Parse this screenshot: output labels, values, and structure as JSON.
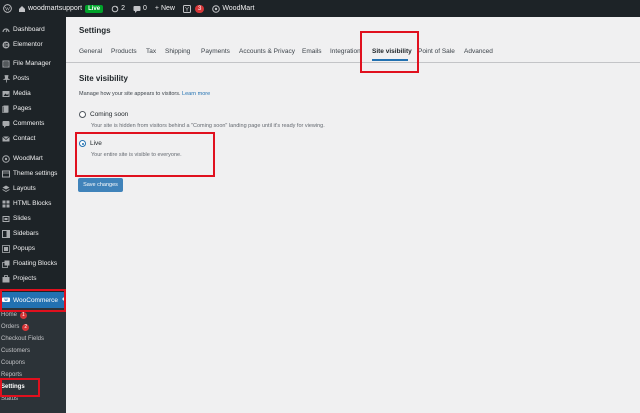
{
  "adminbar": {
    "site_name": "woodmartsupport",
    "live_badge": "Live",
    "updates_count": "2",
    "comments_count": "0",
    "new_label": "+ New",
    "yoast_count": "3",
    "woodmart_label": "WoodMart"
  },
  "sidebar": {
    "items": [
      {
        "label": "Dashboard",
        "icon": "dashboard-icon"
      },
      {
        "label": "Elementor",
        "icon": "elementor-icon"
      },
      {
        "label": "File Manager",
        "icon": "file-manager-icon"
      },
      {
        "label": "Posts",
        "icon": "pushpin-icon"
      },
      {
        "label": "Media",
        "icon": "media-icon"
      },
      {
        "label": "Pages",
        "icon": "pages-icon"
      },
      {
        "label": "Comments",
        "icon": "comments-icon"
      },
      {
        "label": "Contact",
        "icon": "contact-icon"
      },
      {
        "label": "WoodMart",
        "icon": "woodmart-icon"
      },
      {
        "label": "Theme settings",
        "icon": "settings-icon"
      },
      {
        "label": "Layouts",
        "icon": "layouts-icon"
      },
      {
        "label": "HTML Blocks",
        "icon": "html-blocks-icon"
      },
      {
        "label": "Slides",
        "icon": "slides-icon"
      },
      {
        "label": "Sidebars",
        "icon": "sidebars-icon"
      },
      {
        "label": "Popups",
        "icon": "popups-icon"
      },
      {
        "label": "Floating Blocks",
        "icon": "floating-blocks-icon"
      },
      {
        "label": "Projects",
        "icon": "projects-icon"
      }
    ],
    "woocommerce": "WooCommerce",
    "submenu": [
      {
        "label": "Home",
        "badge": "1"
      },
      {
        "label": "Orders",
        "badge": "2"
      },
      {
        "label": "Checkout Fields",
        "badge": ""
      },
      {
        "label": "Customers",
        "badge": ""
      },
      {
        "label": "Coupons",
        "badge": ""
      },
      {
        "label": "Reports",
        "badge": ""
      },
      {
        "label": "Settings",
        "badge": ""
      },
      {
        "label": "Status",
        "badge": ""
      }
    ]
  },
  "main": {
    "title": "Settings",
    "tabs": [
      "General",
      "Products",
      "Tax",
      "Shipping",
      "Payments",
      "Accounts & Privacy",
      "Emails",
      "Integration",
      "Site visibility",
      "Point of Sale",
      "Advanced"
    ],
    "active_tab": "Site visibility",
    "section_title": "Site visibility",
    "section_desc": "Manage how your site appears to visitors.",
    "learn_more": "Learn more",
    "options": [
      {
        "label": "Coming soon",
        "help": "Your site is hidden from visitors behind a \"Coming soon\" landing page until it's ready for viewing.",
        "checked": false
      },
      {
        "label": "Live",
        "help": "Your entire site is visible to everyone.",
        "checked": true
      }
    ],
    "save_label": "Save changes"
  },
  "colors": {
    "accent": "#2271b1",
    "sidebar_bg": "#1d2327",
    "annotation": "#e0101e"
  }
}
